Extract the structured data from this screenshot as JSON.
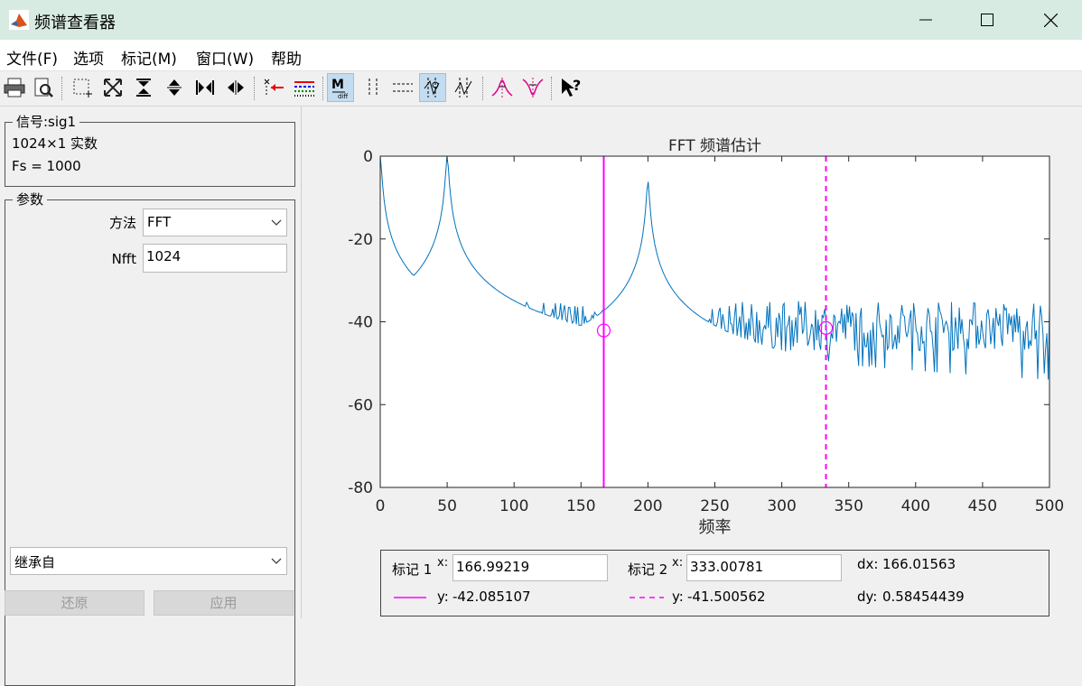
{
  "window": {
    "title": "频谱查看器",
    "min_glyph": "—",
    "max_glyph": "☐",
    "close_glyph": "✕"
  },
  "menu": [
    "文件(F)",
    "选项",
    "标记(M)",
    "窗口(W)",
    "帮助"
  ],
  "toolbar_icons": [
    "print-icon",
    "print-preview-icon",
    "zoom-box-icon",
    "zoom-full-icon",
    "zoom-y-in-icon",
    "zoom-y-out-icon",
    "zoom-x-in-icon",
    "zoom-x-out-icon",
    "import-icon",
    "legend-icon",
    "marker-toggle-icon",
    "vertical-markers-icon",
    "horizontal-markers-icon",
    "track-markers-icon",
    "free-markers-icon",
    "peak-marker-icon",
    "valley-marker-icon",
    "whats-this-icon"
  ],
  "signal_group": {
    "title": "信号:sig1",
    "desc": "1024×1 实数",
    "fs": "Fs = 1000"
  },
  "params_group": {
    "title": "参数",
    "method_label": "方法",
    "method_value": "FFT",
    "nfft_label": "Nfft",
    "nfft_value": "1024",
    "inherit_value": "继承自"
  },
  "buttons": {
    "revert": "还原",
    "apply": "应用"
  },
  "chart_data": {
    "type": "line",
    "title": "FFT 频谱估计",
    "xlabel": "频率",
    "ylabel": "",
    "xlim": [
      0,
      500
    ],
    "ylim": [
      -80,
      0
    ],
    "xticks": [
      0,
      50,
      100,
      150,
      200,
      250,
      300,
      350,
      400,
      450,
      500
    ],
    "yticks": [
      0,
      -20,
      -40,
      -60,
      -80
    ],
    "line_color": "#0072bd",
    "peaks": [
      {
        "x": 0,
        "y": 0
      },
      {
        "x": 50,
        "y": 0
      },
      {
        "x": 200,
        "y": -6
      }
    ],
    "noise_floor": -41,
    "markers": [
      {
        "name": "标记 1",
        "x": 166.99219,
        "y": -42.085107,
        "style": "solid",
        "color": "#ff00ff"
      },
      {
        "name": "标记 2",
        "x": 333.00781,
        "y": -41.500562,
        "style": "dashed",
        "color": "#ff00ff"
      }
    ]
  },
  "marker_panel": {
    "m1_label": "标记 1",
    "x_label": "x:",
    "m1_x": "166.99219",
    "y_label": "y:",
    "m1_y": "-42.085107",
    "m2_label": "标记 2",
    "m2_x": "333.00781",
    "m2_y": "-41.500562",
    "dx_label": "dx:",
    "dx_value": "166.01563",
    "dy_label": "dy:",
    "dy_value": "0.58454439"
  }
}
